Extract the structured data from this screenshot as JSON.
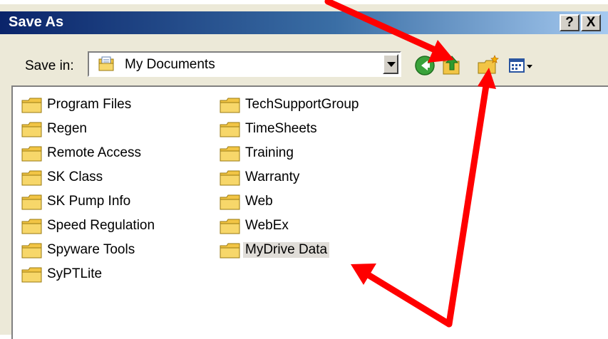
{
  "dialog": {
    "title": "Save As",
    "help_label": "?",
    "close_label": "X"
  },
  "toolbar": {
    "save_in_label": "Save in:",
    "location": "My Documents",
    "buttons": [
      "back",
      "up-one-level",
      "create-new-folder",
      "view-menu"
    ]
  },
  "files": {
    "column1": [
      "Program Files",
      "Regen",
      "Remote Access",
      "SK Class",
      "SK Pump Info",
      "Speed Regulation",
      "Spyware Tools",
      "SyPTLite"
    ],
    "column2": [
      "TechSupportGroup",
      "TimeSheets",
      "Training",
      "Warranty",
      "Web",
      "WebEx",
      "MyDrive Data"
    ],
    "selected": "MyDrive Data"
  },
  "colors": {
    "title_bar": "#0a246a",
    "dialog_bg": "#ece9d8",
    "folder": "#f2c545",
    "arrow": "#ff0000"
  }
}
